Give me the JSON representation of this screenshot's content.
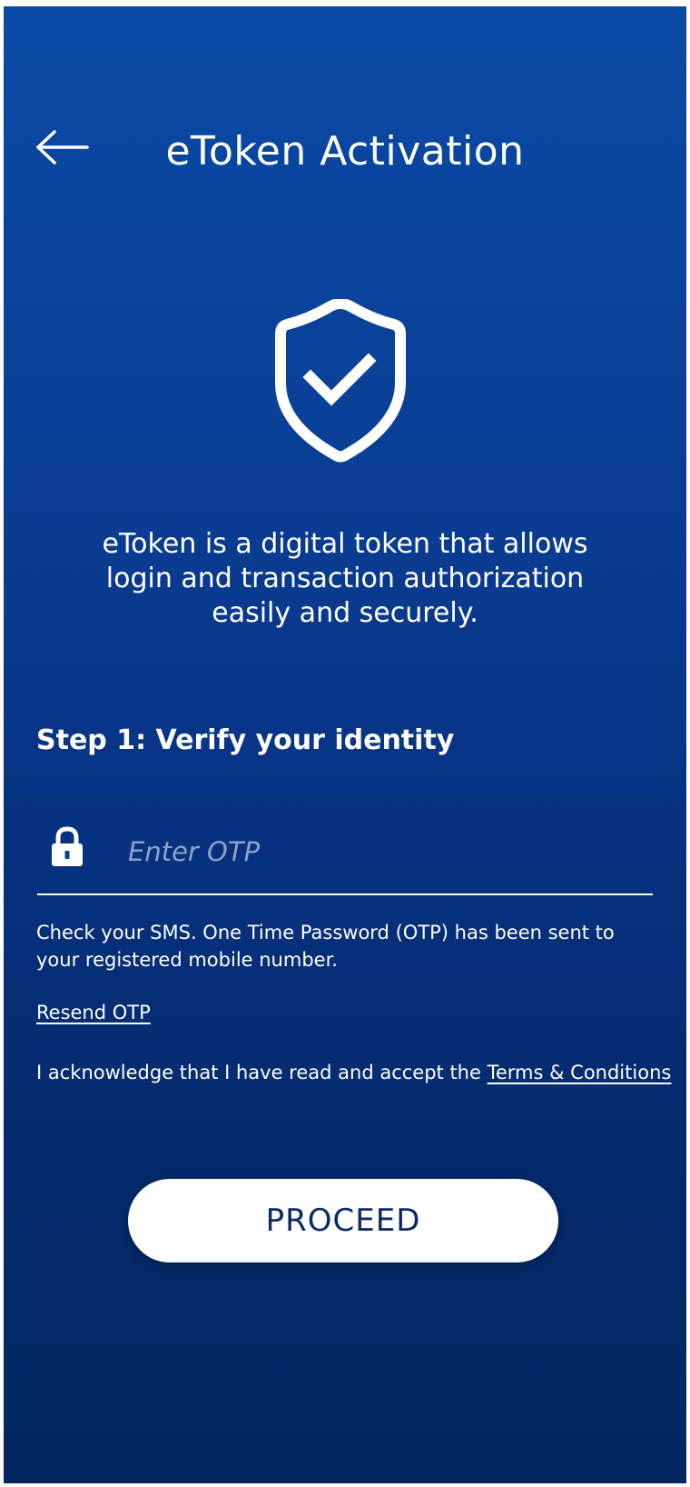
{
  "header": {
    "title": "eToken Activation",
    "back_icon": "arrow-left-icon"
  },
  "hero": {
    "icon": "shield-check-icon",
    "description": "eToken is a digital token that allows login and transaction authorization easily and securely."
  },
  "step": {
    "title": "Step 1: Verify your identity"
  },
  "otp": {
    "icon": "lock-icon",
    "placeholder": "Enter OTP",
    "value": ""
  },
  "sms_note": "Check your SMS. One Time Password (OTP) has been sent to your registered mobile number.",
  "resend_label": "Resend OTP",
  "terms": {
    "prefix": "I acknowledge that I have read and accept the ",
    "link_label": "Terms & Conditions"
  },
  "proceed_label": "PROCEED",
  "colors": {
    "background_top": "#0a4aa6",
    "background_bottom": "#032660",
    "button_text": "#0b2a63"
  }
}
